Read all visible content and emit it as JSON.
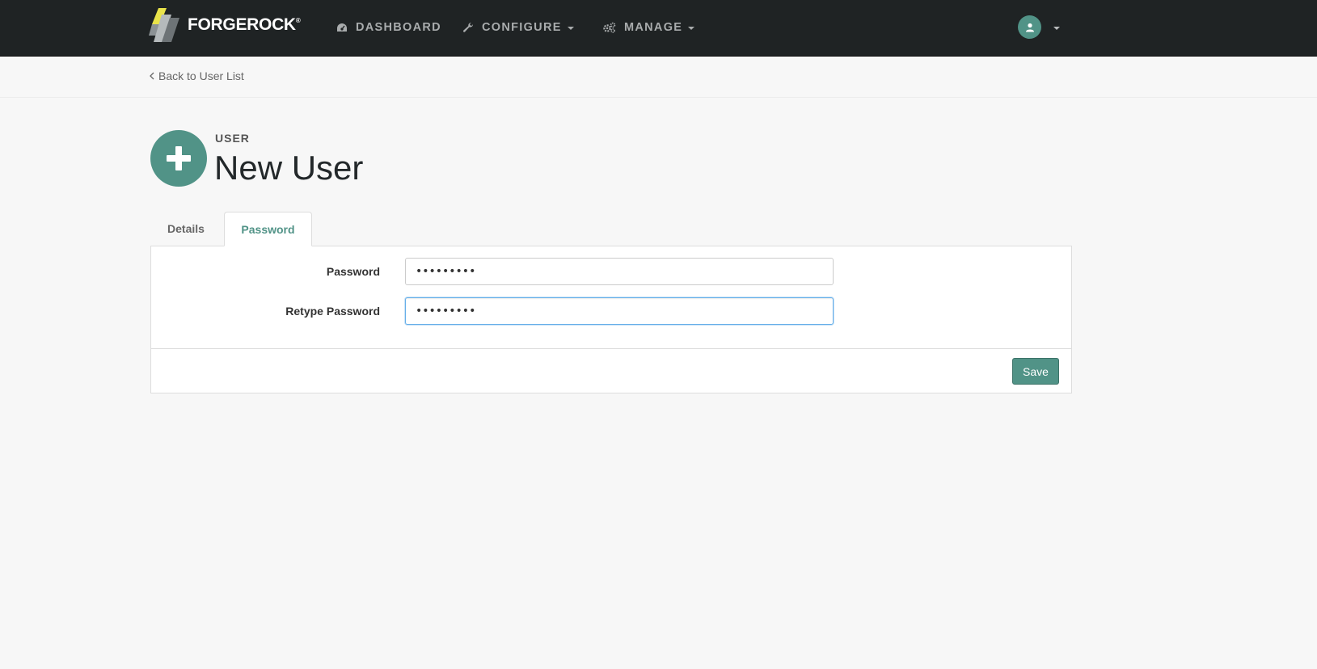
{
  "brand": {
    "name": "FORGEROCK",
    "trademark": "®"
  },
  "nav": {
    "dashboard": "DASHBOARD",
    "configure": "CONFIGURE",
    "manage": "MANAGE"
  },
  "breadcrumb": {
    "back_label": "Back to User List"
  },
  "header": {
    "kicker": "USER",
    "title": "New User"
  },
  "tabs": [
    {
      "label": "Details",
      "active": false
    },
    {
      "label": "Password",
      "active": true
    }
  ],
  "form": {
    "password_label": "Password",
    "password_value": "•••••••••",
    "retype_label": "Retype Password",
    "retype_value": "•••••••••"
  },
  "actions": {
    "save_label": "Save"
  },
  "colors": {
    "accent": "#519387",
    "navbar": "#1f2324",
    "background": "#f7f7f7"
  }
}
